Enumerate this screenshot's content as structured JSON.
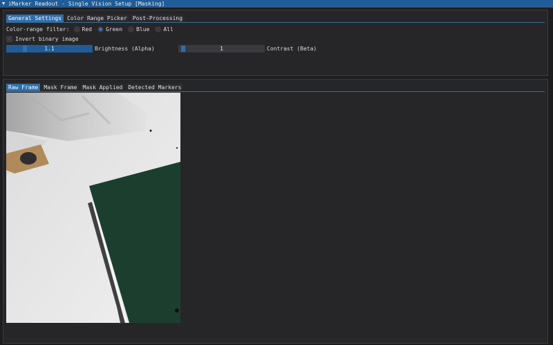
{
  "window": {
    "title": "iMarker Readout - Single Vision Setup [Masking]"
  },
  "settings": {
    "tabs": [
      {
        "label": "General Settings",
        "active": true
      },
      {
        "label": "Color Range Picker",
        "active": false
      },
      {
        "label": "Post-Processing",
        "active": false
      }
    ],
    "filter_label": "Color-range filter:",
    "filter_options": [
      {
        "label": "Red",
        "selected": false
      },
      {
        "label": "Green",
        "selected": true
      },
      {
        "label": "Blue",
        "selected": false
      },
      {
        "label": "All",
        "selected": false
      }
    ],
    "invert_label": "Invert binary image",
    "invert_checked": false,
    "brightness": {
      "value": "1.1",
      "label": "Brightness (Alpha)",
      "level": 1.0
    },
    "contrast": {
      "value": "1",
      "label": "Contrast (Beta)",
      "level": 0.03
    }
  },
  "frames": {
    "tabs": [
      {
        "label": "Raw Frame",
        "active": true
      },
      {
        "label": "Mask Frame",
        "active": false
      },
      {
        "label": "Mask Applied",
        "active": false
      },
      {
        "label": "Detected Markers",
        "active": false
      }
    ]
  },
  "colors": {
    "accent": "#2f6ea8",
    "titlebar": "#1f5c98",
    "background": "#1d1d1f",
    "panel": "#262628",
    "board_green": "#1c3e2f"
  },
  "icons": {
    "collapse": "triangle-down-icon",
    "checkmark": "checkmark-icon"
  }
}
